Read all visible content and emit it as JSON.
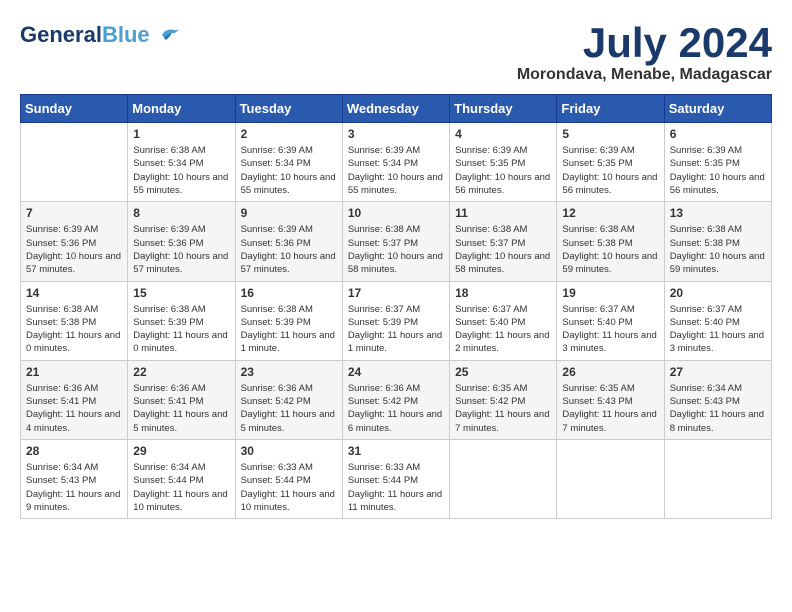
{
  "logo": {
    "part1": "General",
    "part2": "Blue"
  },
  "header": {
    "month": "July 2024",
    "location": "Morondava, Menabe, Madagascar"
  },
  "days_of_week": [
    "Sunday",
    "Monday",
    "Tuesday",
    "Wednesday",
    "Thursday",
    "Friday",
    "Saturday"
  ],
  "weeks": [
    [
      {
        "day": "",
        "sunrise": "",
        "sunset": "",
        "daylight": ""
      },
      {
        "day": "1",
        "sunrise": "Sunrise: 6:38 AM",
        "sunset": "Sunset: 5:34 PM",
        "daylight": "Daylight: 10 hours and 55 minutes."
      },
      {
        "day": "2",
        "sunrise": "Sunrise: 6:39 AM",
        "sunset": "Sunset: 5:34 PM",
        "daylight": "Daylight: 10 hours and 55 minutes."
      },
      {
        "day": "3",
        "sunrise": "Sunrise: 6:39 AM",
        "sunset": "Sunset: 5:34 PM",
        "daylight": "Daylight: 10 hours and 55 minutes."
      },
      {
        "day": "4",
        "sunrise": "Sunrise: 6:39 AM",
        "sunset": "Sunset: 5:35 PM",
        "daylight": "Daylight: 10 hours and 56 minutes."
      },
      {
        "day": "5",
        "sunrise": "Sunrise: 6:39 AM",
        "sunset": "Sunset: 5:35 PM",
        "daylight": "Daylight: 10 hours and 56 minutes."
      },
      {
        "day": "6",
        "sunrise": "Sunrise: 6:39 AM",
        "sunset": "Sunset: 5:35 PM",
        "daylight": "Daylight: 10 hours and 56 minutes."
      }
    ],
    [
      {
        "day": "7",
        "sunrise": "Sunrise: 6:39 AM",
        "sunset": "Sunset: 5:36 PM",
        "daylight": "Daylight: 10 hours and 57 minutes."
      },
      {
        "day": "8",
        "sunrise": "Sunrise: 6:39 AM",
        "sunset": "Sunset: 5:36 PM",
        "daylight": "Daylight: 10 hours and 57 minutes."
      },
      {
        "day": "9",
        "sunrise": "Sunrise: 6:39 AM",
        "sunset": "Sunset: 5:36 PM",
        "daylight": "Daylight: 10 hours and 57 minutes."
      },
      {
        "day": "10",
        "sunrise": "Sunrise: 6:38 AM",
        "sunset": "Sunset: 5:37 PM",
        "daylight": "Daylight: 10 hours and 58 minutes."
      },
      {
        "day": "11",
        "sunrise": "Sunrise: 6:38 AM",
        "sunset": "Sunset: 5:37 PM",
        "daylight": "Daylight: 10 hours and 58 minutes."
      },
      {
        "day": "12",
        "sunrise": "Sunrise: 6:38 AM",
        "sunset": "Sunset: 5:38 PM",
        "daylight": "Daylight: 10 hours and 59 minutes."
      },
      {
        "day": "13",
        "sunrise": "Sunrise: 6:38 AM",
        "sunset": "Sunset: 5:38 PM",
        "daylight": "Daylight: 10 hours and 59 minutes."
      }
    ],
    [
      {
        "day": "14",
        "sunrise": "Sunrise: 6:38 AM",
        "sunset": "Sunset: 5:38 PM",
        "daylight": "Daylight: 11 hours and 0 minutes."
      },
      {
        "day": "15",
        "sunrise": "Sunrise: 6:38 AM",
        "sunset": "Sunset: 5:39 PM",
        "daylight": "Daylight: 11 hours and 0 minutes."
      },
      {
        "day": "16",
        "sunrise": "Sunrise: 6:38 AM",
        "sunset": "Sunset: 5:39 PM",
        "daylight": "Daylight: 11 hours and 1 minute."
      },
      {
        "day": "17",
        "sunrise": "Sunrise: 6:37 AM",
        "sunset": "Sunset: 5:39 PM",
        "daylight": "Daylight: 11 hours and 1 minute."
      },
      {
        "day": "18",
        "sunrise": "Sunrise: 6:37 AM",
        "sunset": "Sunset: 5:40 PM",
        "daylight": "Daylight: 11 hours and 2 minutes."
      },
      {
        "day": "19",
        "sunrise": "Sunrise: 6:37 AM",
        "sunset": "Sunset: 5:40 PM",
        "daylight": "Daylight: 11 hours and 3 minutes."
      },
      {
        "day": "20",
        "sunrise": "Sunrise: 6:37 AM",
        "sunset": "Sunset: 5:40 PM",
        "daylight": "Daylight: 11 hours and 3 minutes."
      }
    ],
    [
      {
        "day": "21",
        "sunrise": "Sunrise: 6:36 AM",
        "sunset": "Sunset: 5:41 PM",
        "daylight": "Daylight: 11 hours and 4 minutes."
      },
      {
        "day": "22",
        "sunrise": "Sunrise: 6:36 AM",
        "sunset": "Sunset: 5:41 PM",
        "daylight": "Daylight: 11 hours and 5 minutes."
      },
      {
        "day": "23",
        "sunrise": "Sunrise: 6:36 AM",
        "sunset": "Sunset: 5:42 PM",
        "daylight": "Daylight: 11 hours and 5 minutes."
      },
      {
        "day": "24",
        "sunrise": "Sunrise: 6:36 AM",
        "sunset": "Sunset: 5:42 PM",
        "daylight": "Daylight: 11 hours and 6 minutes."
      },
      {
        "day": "25",
        "sunrise": "Sunrise: 6:35 AM",
        "sunset": "Sunset: 5:42 PM",
        "daylight": "Daylight: 11 hours and 7 minutes."
      },
      {
        "day": "26",
        "sunrise": "Sunrise: 6:35 AM",
        "sunset": "Sunset: 5:43 PM",
        "daylight": "Daylight: 11 hours and 7 minutes."
      },
      {
        "day": "27",
        "sunrise": "Sunrise: 6:34 AM",
        "sunset": "Sunset: 5:43 PM",
        "daylight": "Daylight: 11 hours and 8 minutes."
      }
    ],
    [
      {
        "day": "28",
        "sunrise": "Sunrise: 6:34 AM",
        "sunset": "Sunset: 5:43 PM",
        "daylight": "Daylight: 11 hours and 9 minutes."
      },
      {
        "day": "29",
        "sunrise": "Sunrise: 6:34 AM",
        "sunset": "Sunset: 5:44 PM",
        "daylight": "Daylight: 11 hours and 10 minutes."
      },
      {
        "day": "30",
        "sunrise": "Sunrise: 6:33 AM",
        "sunset": "Sunset: 5:44 PM",
        "daylight": "Daylight: 11 hours and 10 minutes."
      },
      {
        "day": "31",
        "sunrise": "Sunrise: 6:33 AM",
        "sunset": "Sunset: 5:44 PM",
        "daylight": "Daylight: 11 hours and 11 minutes."
      },
      {
        "day": "",
        "sunrise": "",
        "sunset": "",
        "daylight": ""
      },
      {
        "day": "",
        "sunrise": "",
        "sunset": "",
        "daylight": ""
      },
      {
        "day": "",
        "sunrise": "",
        "sunset": "",
        "daylight": ""
      }
    ]
  ]
}
